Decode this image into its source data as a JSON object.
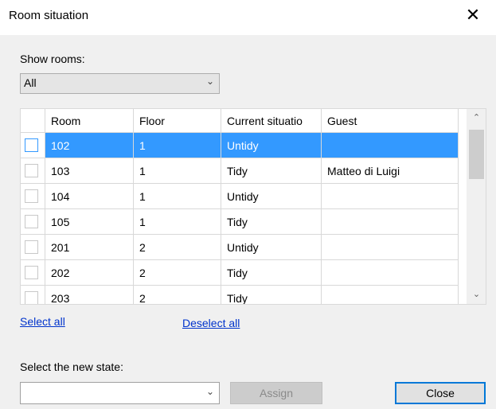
{
  "window": {
    "title": "Room situation",
    "close_glyph": "✕"
  },
  "filter": {
    "label": "Show rooms:",
    "value": "All"
  },
  "table": {
    "columns": [
      "",
      "Room",
      "Floor",
      "Current situatio",
      "Guest"
    ],
    "rows": [
      {
        "room": "102",
        "floor": "1",
        "situation": "Untidy",
        "guest": "",
        "selected": true
      },
      {
        "room": "103",
        "floor": "1",
        "situation": "Tidy",
        "guest": "Matteo di Luigi",
        "selected": false
      },
      {
        "room": "104",
        "floor": "1",
        "situation": "Untidy",
        "guest": "",
        "selected": false
      },
      {
        "room": "105",
        "floor": "1",
        "situation": "Tidy",
        "guest": "",
        "selected": false
      },
      {
        "room": "201",
        "floor": "2",
        "situation": "Untidy",
        "guest": "",
        "selected": false
      },
      {
        "room": "202",
        "floor": "2",
        "situation": "Tidy",
        "guest": "",
        "selected": false
      },
      {
        "room": "203",
        "floor": "2",
        "situation": "Tidy",
        "guest": "",
        "selected": false
      }
    ]
  },
  "links": {
    "select_all": "Select all",
    "deselect_all": "Deselect all"
  },
  "new_state": {
    "label": "Select the new state:",
    "value": ""
  },
  "buttons": {
    "assign": "Assign",
    "close": "Close"
  },
  "icons": {
    "chevron": "chevron-down-icon",
    "scroll_up": "scroll-up-icon",
    "scroll_down": "scroll-down-icon"
  },
  "colors": {
    "selection": "#3399ff",
    "link": "#0033cc",
    "focus_border": "#0078d7"
  }
}
